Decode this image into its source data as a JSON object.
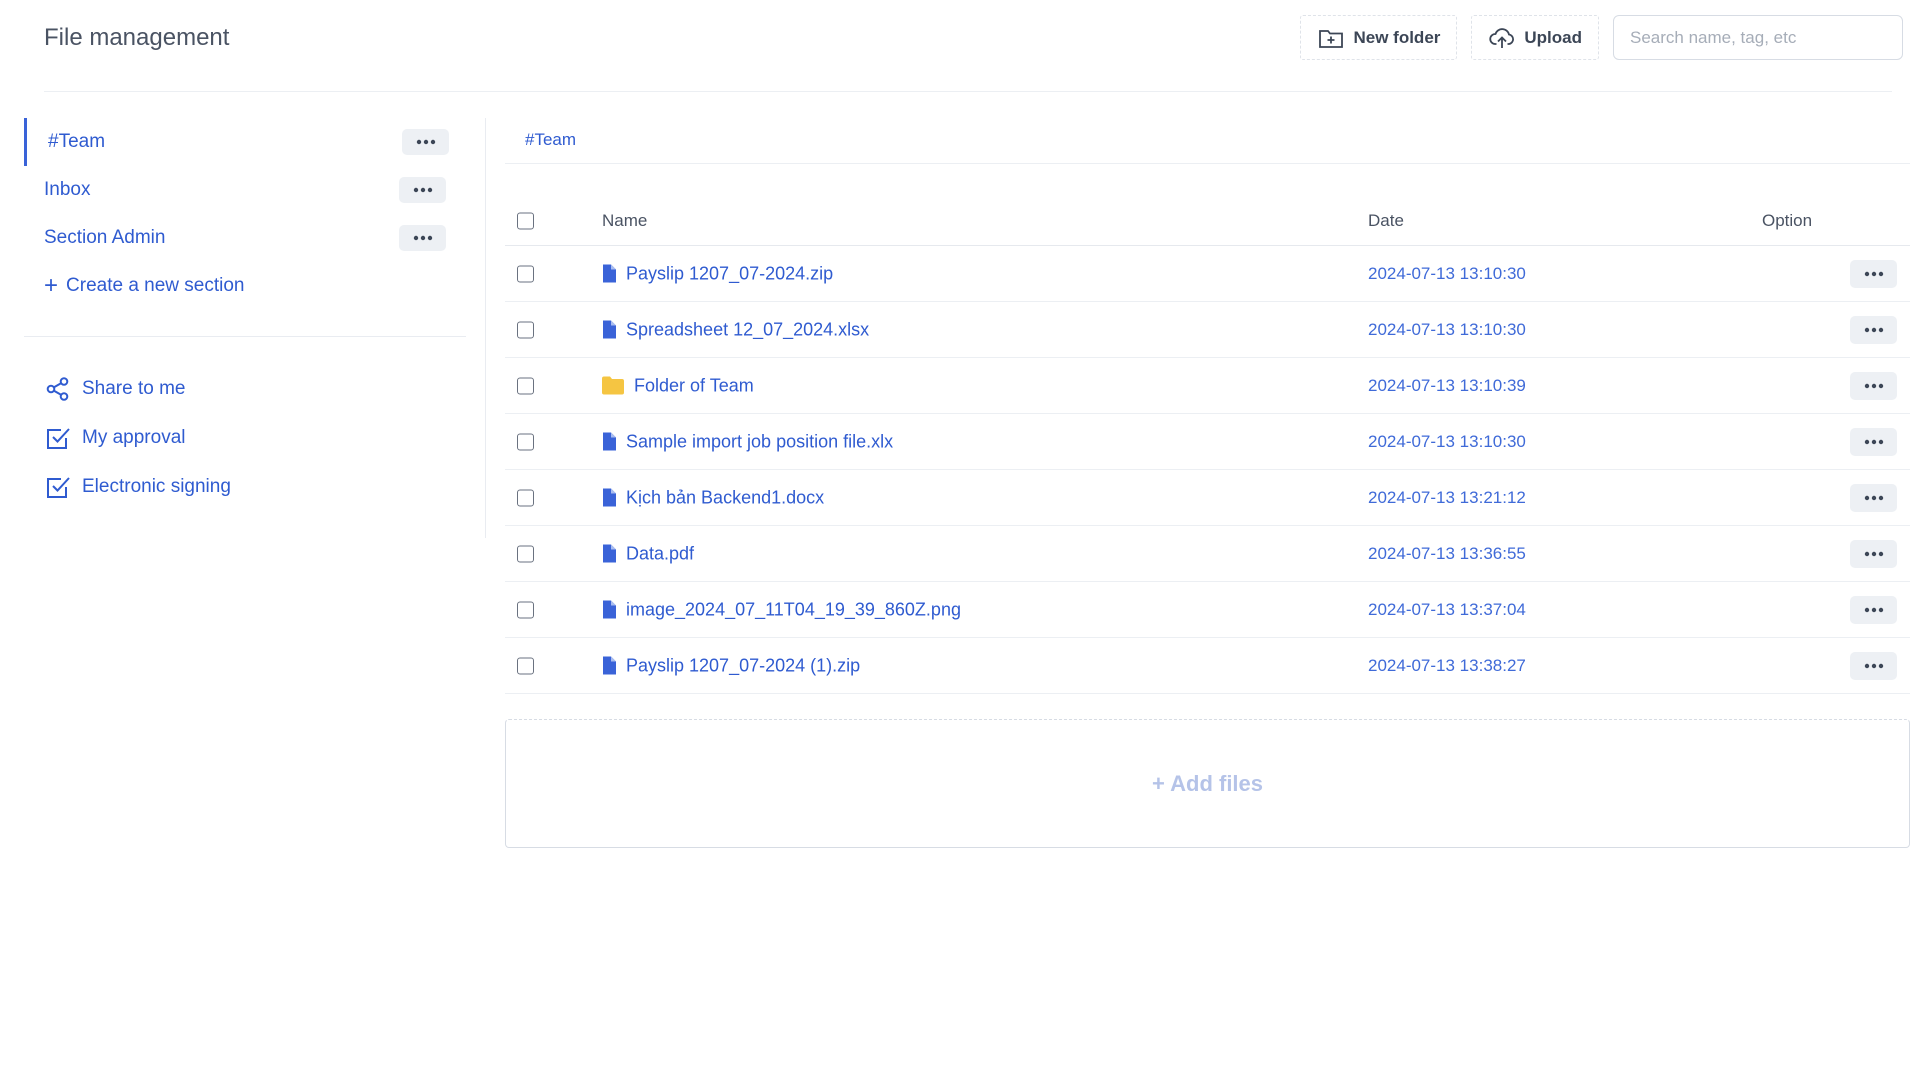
{
  "header": {
    "title": "File management",
    "new_folder_label": "New folder",
    "upload_label": "Upload",
    "search_placeholder": "Search name, tag, etc"
  },
  "sidebar": {
    "sections": [
      {
        "label": "#Team",
        "active": true
      },
      {
        "label": "Inbox",
        "active": false
      },
      {
        "label": "Section Admin",
        "active": false
      }
    ],
    "create_section": {
      "icon": "plus-icon",
      "label": "Create a new section"
    },
    "nav": [
      {
        "icon": "share-icon",
        "label": "Share to me"
      },
      {
        "icon": "checkbox-icon",
        "label": "My approval"
      },
      {
        "icon": "checkbox-icon",
        "label": "Electronic signing"
      }
    ]
  },
  "main": {
    "breadcrumb": "#Team",
    "columns": {
      "name": "Name",
      "date": "Date",
      "option": "Option"
    },
    "files": [
      {
        "type": "file",
        "name": "Payslip 1207_07-2024.zip",
        "date": "2024-07-13 13:10:30"
      },
      {
        "type": "file",
        "name": "Spreadsheet 12_07_2024.xlsx",
        "date": "2024-07-13 13:10:30"
      },
      {
        "type": "folder",
        "name": "Folder of Team",
        "date": "2024-07-13 13:10:39"
      },
      {
        "type": "file",
        "name": "Sample import job position file.xlx",
        "date": "2024-07-13 13:10:30"
      },
      {
        "type": "file",
        "name": "Kịch bản Backend1.docx",
        "date": "2024-07-13 13:21:12"
      },
      {
        "type": "file",
        "name": "Data.pdf",
        "date": "2024-07-13 13:36:55"
      },
      {
        "type": "file",
        "name": "image_2024_07_11T04_19_39_860Z.png",
        "date": "2024-07-13 13:37:04"
      },
      {
        "type": "file",
        "name": "Payslip 1207_07-2024 (1).zip",
        "date": "2024-07-13 13:38:27"
      }
    ],
    "add_files_label": "+ Add files"
  },
  "colors": {
    "accent": "#2f5bd0",
    "folder": "#f5c542",
    "divider": "#eceff3"
  }
}
